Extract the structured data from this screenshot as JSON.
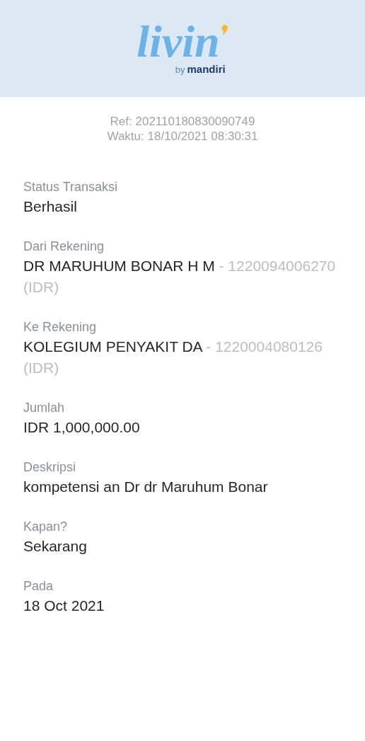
{
  "header": {
    "logo": "livin",
    "logo_suffix": "by",
    "logo_brand": "mandiri"
  },
  "meta": {
    "ref": "Ref: 202110180830090749",
    "time": "Waktu: 18/10/2021 08:30:31"
  },
  "fields": [
    {
      "label": "Status Transaksi",
      "value": "Berhasil"
    },
    {
      "label": "Dari Rekening",
      "value": "DR MARUHUM BONAR H M",
      "account": "- 1220094006270 (IDR)"
    },
    {
      "label": "Ke Rekening",
      "value": "KOLEGIUM PENYAKIT DA",
      "account": "- 1220004080126 (IDR)"
    },
    {
      "label": "Jumlah",
      "value": "IDR 1,000,000.00"
    },
    {
      "label": "Deskripsi",
      "value": "kompetensi an Dr dr Maruhum Bonar"
    },
    {
      "label": "Kapan?",
      "value": "Sekarang"
    },
    {
      "label": "Pada",
      "value": "18 Oct 2021"
    }
  ]
}
